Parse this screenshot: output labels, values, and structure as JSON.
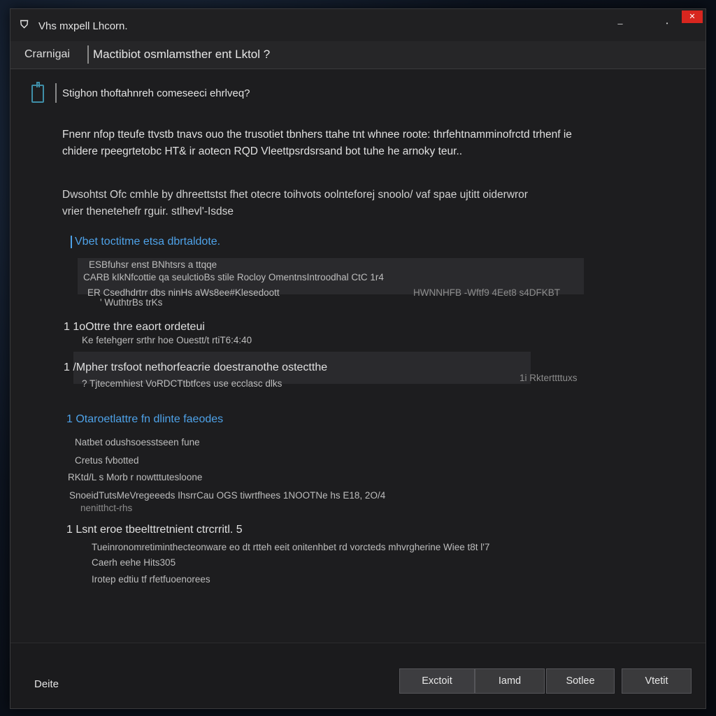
{
  "window": {
    "title": "Vhs mxpell Lhcorn.",
    "app_icon": "shield-icon",
    "controls": {
      "minimize": "–",
      "maximize": "▪",
      "dot": "•",
      "close": "✕"
    }
  },
  "header": {
    "label": "Crarnigai",
    "title": "Mactibiot osmlamsther ent Lktol ?"
  },
  "section": {
    "icon": "clipboard-icon",
    "title": "Stighon thoftahnreh comeseeci ehrlveq?",
    "para1_line1": "Fnenr nfop tteufe ttvstb tnavs ouo the trusotiet tbnhers ttahe tnt whnee roote: thrfehtnamminofrctd trhenf ie",
    "para1_line2": "chidere rpeegrtetobc HT& ir aotecn RQD Vleettpsrdsrsand bot tuhe he arnoky teur..",
    "para2_line1": "Dwsohtst Ofc cmhle by dhreettstst fhet otecre toihvots oolnteforej snoolo/ vaf spae ujtitt oiderwror",
    "para2_line2": "vrier thenetehefr rguir. stlhevl'-Isdse"
  },
  "group1": {
    "heading": "Vbet toctitme etsa dbrtaldote.",
    "l1": "ESBfuhsr enst BNhtsrs a ttqqe",
    "l2": "CARB kIkNfcottie qa seulctioBs stile Rocloy OmentnsIntroodhal CtC 1r4",
    "l3": "ER Csedhdrtrr dbs ninHs aWs8ee#Klesedoott",
    "l4": "' WuthtrBs trKs",
    "right3": "HWNNHFB -Wftf9  4Eet8  s4DFKBT"
  },
  "item2": {
    "heading": "1 1oOttre thre eaort ordeteui",
    "sub": "Ke fetehgerr srthr hoe Ouestt/t rtiT6:4:40"
  },
  "item3": {
    "heading": "1 /Mpher trsfoot nethorfeacrie doestranothe ostectthe",
    "sub": "? Tjtecemhiest VoRDCTtbtfces use ecclasc dlks",
    "right": "1i Rkterttttuxs"
  },
  "group2": {
    "heading": "1 Otaroetlattre fn dlinte faeodes",
    "l1": "Natbet odushsoesstseen fune",
    "l2": "Cretus fvbotted",
    "l3": "RKtd/L s Morb r nowtttutesloone",
    "l4": "SnoeidTutsMeVregeeeds IhsrrCau OGS tiwrtfhees 1NOOTNe hs E18, 2O/4",
    "l5": "nenitthct-rhs"
  },
  "item5": {
    "heading": "1 Lsnt eroe tbeelttretnient ctrcrritl. 5",
    "l1": "Tueinronomretiminthecteonware eo dt rtteh eeit onitenhbet rd vorcteds mhvrgherine Wiee t8t l'7",
    "l2": "Caerh eehe Hits305",
    "l3": "Irotep edtiu tf rfetfuoenorees"
  },
  "footer": {
    "label": "Deite",
    "buttons": [
      "Exctoit",
      "Iamd",
      "Sotlee",
      "Vtetit"
    ]
  },
  "colors": {
    "accent_link": "#4ea2e8",
    "close_button": "#d8261f",
    "background": "#1d1d1f"
  }
}
